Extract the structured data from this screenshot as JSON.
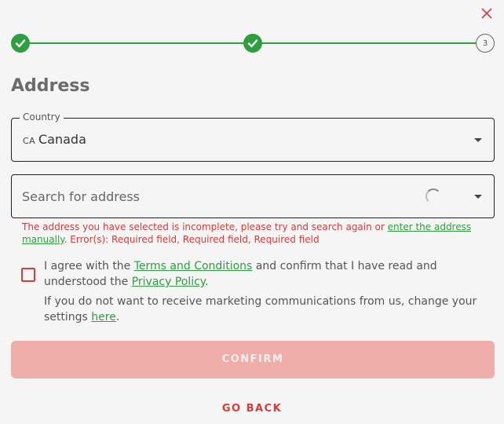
{
  "stepper": {
    "steps": [
      {
        "state": "complete",
        "label": ""
      },
      {
        "state": "complete",
        "label": ""
      },
      {
        "state": "current",
        "label": "3"
      }
    ]
  },
  "form": {
    "title": "Address",
    "country": {
      "legend": "Country",
      "code": "CA",
      "value": "Canada"
    },
    "address": {
      "placeholder": "Search for address",
      "value": ""
    },
    "error": {
      "text_before": "The address you have selected is incomplete, please try and search again or ",
      "link": "enter the address manually",
      "text_after": ". Error(s): Required field, Required field, Required field"
    },
    "consent": {
      "text_1": "I agree with the ",
      "terms_link": "Terms and Conditions",
      "text_2": " and confirm that I have read and understood the ",
      "privacy_link": "Privacy Policy",
      "text_3": "."
    },
    "marketing": {
      "text_1": "If you do not want to receive marketing communications from us, change your settings ",
      "link": "here",
      "text_2": "."
    },
    "confirm_label": "CONFIRM",
    "go_back_label": "GO BACK"
  },
  "colors": {
    "accent_green": "#2e9e3e",
    "error_red": "#d83a3a",
    "confirm_disabled": "#efaea9",
    "background": "#f5f5f5"
  }
}
